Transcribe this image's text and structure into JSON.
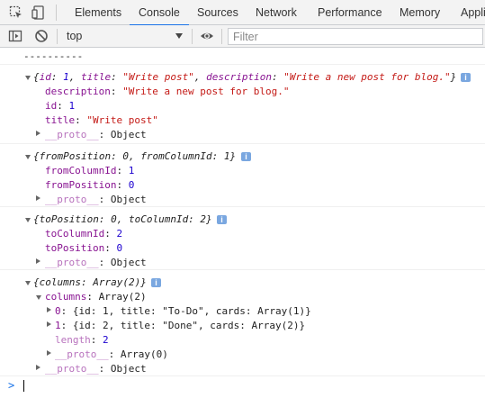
{
  "tabs": [
    {
      "label": "Elements"
    },
    {
      "label": "Console",
      "active": true
    },
    {
      "label": "Sources"
    },
    {
      "label": "Network"
    },
    {
      "label": "Performance"
    },
    {
      "label": "Memory"
    },
    {
      "label": "Appli"
    }
  ],
  "toolbar": {
    "context": "top",
    "filter_placeholder": "Filter"
  },
  "icons": {
    "inspect": "inspect-element-icon",
    "device": "device-toolbar-icon",
    "sidebar": "sidebar-toggle-icon",
    "clear": "clear-console-icon",
    "eye": "live-expression-icon",
    "info": "info-icon",
    "prompt": "prompt-chevron-icon"
  },
  "colors": {
    "accent": "#1a73e8",
    "key": "#881391",
    "string": "#c41a16",
    "number": "#1c00cf",
    "info_badge": "#7aa7e0"
  },
  "console": {
    "separator": "----------",
    "msg1": {
      "summary_open": "{",
      "summary_k1": "id",
      "summary_v1": "1",
      "summary_k2": "title",
      "summary_v2": "\"Write post\"",
      "summary_k3": "description",
      "summary_v3": "\"Write a new post for blog.\"",
      "summary_close": "}",
      "props": [
        {
          "key": "description",
          "value": "\"Write a new post for blog.\""
        },
        {
          "key": "id",
          "value": "1"
        },
        {
          "key": "title",
          "value": "\"Write post\""
        }
      ],
      "proto_key": "__proto__",
      "proto_value": "Object"
    },
    "msg2": {
      "summary": "{fromPosition: 0, fromColumnId: 1}",
      "props": [
        {
          "key": "fromColumnId",
          "value": "1"
        },
        {
          "key": "fromPosition",
          "value": "0"
        }
      ],
      "proto_key": "__proto__",
      "proto_value": "Object"
    },
    "msg3": {
      "summary": "{toPosition: 0, toColumnId: 2}",
      "props": [
        {
          "key": "toColumnId",
          "value": "2"
        },
        {
          "key": "toPosition",
          "value": "0"
        }
      ],
      "proto_key": "__proto__",
      "proto_value": "Object"
    },
    "msg4": {
      "summary": "{columns: Array(2)}",
      "columns_key": "columns",
      "columns_value": "Array(2)",
      "item0_key": "0",
      "item0_value": "{id: 1, title: \"To-Do\", cards: Array(1)}",
      "item1_key": "1",
      "item1_value": "{id: 2, title: \"Done\", cards: Array(2)}",
      "length_key": "length",
      "length_value": "2",
      "array_proto_key": "__proto__",
      "array_proto_value": "Array(0)",
      "proto_key": "__proto__",
      "proto_value": "Object"
    },
    "prompt": ">"
  }
}
